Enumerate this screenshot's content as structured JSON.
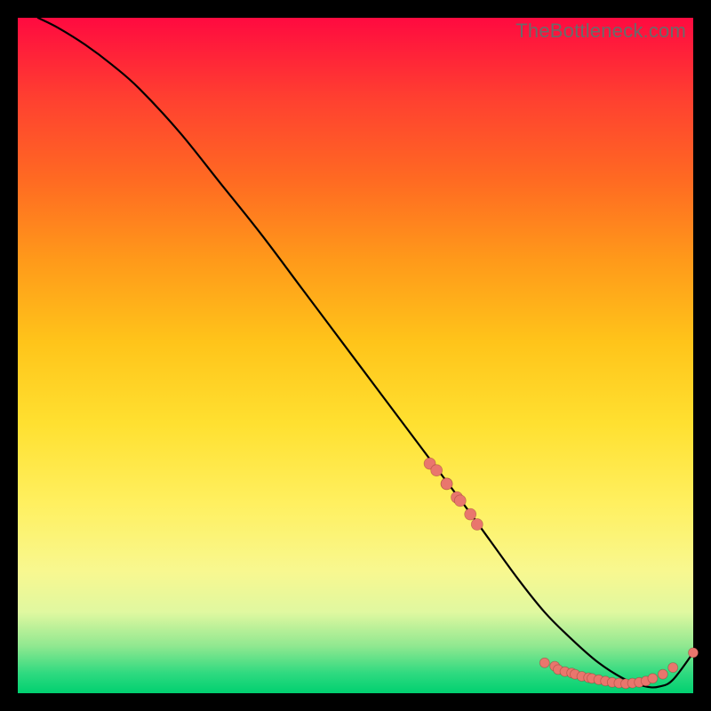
{
  "watermark": "TheBottleneck.com",
  "colors": {
    "point_fill": "#e9766d",
    "curve_stroke": "#000000"
  },
  "chart_data": {
    "type": "line",
    "title": "",
    "xlabel": "",
    "ylabel": "",
    "xlim": [
      0,
      100
    ],
    "ylim": [
      0,
      100
    ],
    "grid": false,
    "note": "No axis ticks or numeric labels are shown in the image; values are read off the 0–100 plot-area coordinate system (origin bottom-left).",
    "series": [
      {
        "name": "curve",
        "kind": "line",
        "x": [
          3,
          6,
          10,
          14,
          18,
          24,
          30,
          36,
          42,
          48,
          54,
          60,
          66,
          70,
          74,
          78,
          82,
          86,
          90,
          93,
          95,
          97,
          100
        ],
        "y": [
          100,
          98.5,
          96,
          93,
          89.5,
          83,
          75.5,
          68,
          60,
          52,
          44,
          36,
          28,
          22.5,
          17,
          12,
          8,
          4.5,
          2,
          1,
          1,
          2,
          6
        ]
      },
      {
        "name": "points-upper",
        "kind": "scatter",
        "x": [
          61,
          62,
          63.5,
          63.5,
          65,
          65.5,
          67,
          68
        ],
        "y": [
          34,
          33,
          31,
          31,
          29,
          28.5,
          26.5,
          25
        ]
      },
      {
        "name": "points-lower",
        "kind": "scatter",
        "x": [
          78,
          79.5,
          80,
          81,
          82,
          82.5,
          83.5,
          84.5,
          85,
          86,
          87,
          88,
          89,
          90,
          91,
          92,
          93,
          94,
          95.5,
          97,
          100
        ],
        "y": [
          4.5,
          4,
          3.5,
          3.2,
          3,
          2.8,
          2.5,
          2.3,
          2.2,
          2,
          1.8,
          1.6,
          1.5,
          1.4,
          1.5,
          1.6,
          1.8,
          2.2,
          2.8,
          3.8,
          6
        ]
      }
    ]
  }
}
